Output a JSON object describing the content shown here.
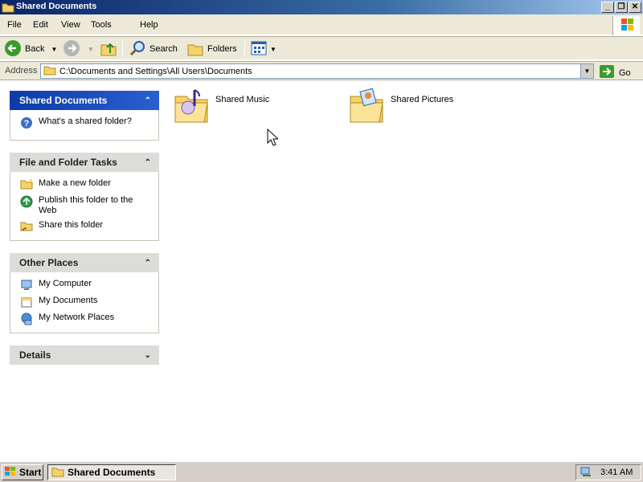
{
  "window": {
    "title": "Shared Documents",
    "buttons": [
      "minimize",
      "restore",
      "close"
    ]
  },
  "menu": [
    "File",
    "Edit",
    "View",
    "Tools",
    "Help"
  ],
  "toolbar": {
    "back": "Back",
    "search": "Search",
    "folders": "Folders"
  },
  "address": {
    "label": "Address",
    "path": "C:\\Documents and Settings\\All Users\\Documents",
    "go": "Go"
  },
  "taskpane": {
    "shared_documents": {
      "title": "Shared Documents",
      "items": [
        {
          "label": "What's a shared folder?",
          "icon": "help-icon"
        }
      ]
    },
    "file_folder_tasks": {
      "title": "File and Folder Tasks",
      "items": [
        {
          "label": "Make a new folder",
          "icon": "new-folder-icon"
        },
        {
          "label": "Publish this folder to the Web",
          "icon": "publish-web-icon"
        },
        {
          "label": "Share this folder",
          "icon": "share-folder-icon"
        }
      ]
    },
    "other_places": {
      "title": "Other Places",
      "items": [
        {
          "label": "My Computer",
          "icon": "computer-icon"
        },
        {
          "label": "My Documents",
          "icon": "documents-icon"
        },
        {
          "label": "My Network Places",
          "icon": "network-icon"
        }
      ]
    },
    "details": {
      "title": "Details"
    }
  },
  "content": {
    "items": [
      {
        "label": "Shared Music",
        "icon": "music-folder-icon"
      },
      {
        "label": "Shared Pictures",
        "icon": "pictures-folder-icon"
      }
    ]
  },
  "taskbar": {
    "start": "Start",
    "task": "Shared Documents",
    "clock": "3:41 AM"
  },
  "colors": {
    "title_bar": "#0a246a",
    "task_pane_header": "#0c3ba8",
    "chrome": "#ece9d8"
  }
}
